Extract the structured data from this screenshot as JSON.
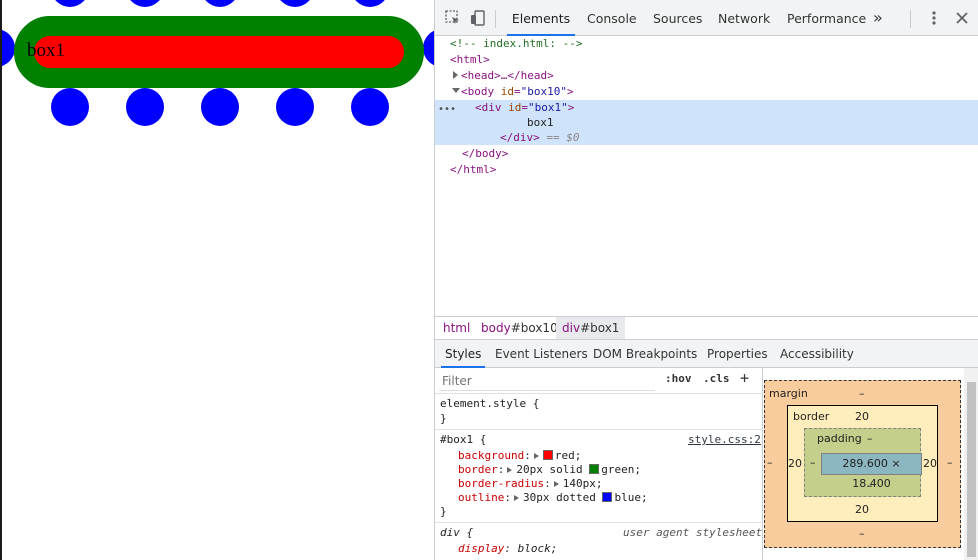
{
  "page": {
    "box1_text": "box1",
    "colors": {
      "dots": "#0000ff",
      "border": "#008000",
      "background": "#ff0000"
    }
  },
  "devtools": {
    "tabs": [
      "Elements",
      "Console",
      "Sources",
      "Network",
      "Performance"
    ],
    "more_tabs": "»",
    "active_tab": "Elements",
    "tree": {
      "comment": "<!-- index.html: -->",
      "html_open": "<html>",
      "head": "<head>…</head>",
      "body_tag": "body",
      "body_attr": "id",
      "body_val": "\"box10\"",
      "div_tag": "div",
      "div_attr": "id",
      "div_val": "\"box1\"",
      "div_text": "box1",
      "div_close": "</div>",
      "div_eq": "== $0",
      "ellipsis": "•••",
      "body_close": "</body>",
      "html_close": "</html>"
    },
    "breadcrumbs": [
      {
        "tag": "html",
        "id": ""
      },
      {
        "tag": "body",
        "id": "#box10"
      },
      {
        "tag": "div",
        "id": "#box1"
      }
    ],
    "subtabs": [
      "Styles",
      "Event Listeners",
      "DOM Breakpoints",
      "Properties",
      "Accessibility"
    ],
    "active_subtab": "Styles",
    "styles": {
      "filter_placeholder": "Filter",
      "hov": ":hov",
      "cls": ".cls",
      "plus": "+",
      "element_style": "element.style {",
      "close_brace": "}",
      "rule_selector": "#box1 {",
      "rule_source": "style.css:2",
      "decls": [
        {
          "prop": "background",
          "value": "red;",
          "swatch": "#ff0000"
        },
        {
          "prop": "border",
          "value": "20px solid",
          "swatch": "#008000",
          "value2": "green;"
        },
        {
          "prop": "border-radius",
          "value": "140px;"
        },
        {
          "prop": "outline",
          "value": "30px dotted",
          "swatch": "#0000ff",
          "value2": "blue;"
        }
      ],
      "ua_selector": "div {",
      "ua_source": "user agent stylesheet",
      "ua_prop": "display",
      "ua_value": "block;"
    },
    "box_model": {
      "margin_label": "margin",
      "margin_top": "–",
      "margin_bottom": "–",
      "margin_left": "–",
      "margin_right": "–",
      "border_label": "border",
      "border_top": "20",
      "border_bottom": "20",
      "border_left": "20",
      "border_right": "20",
      "padding_label": "padding",
      "padding_top": "–",
      "padding_bottom": "–",
      "padding_left": "–",
      "padding_right": "–",
      "content": "289.600 × 18.400"
    }
  }
}
